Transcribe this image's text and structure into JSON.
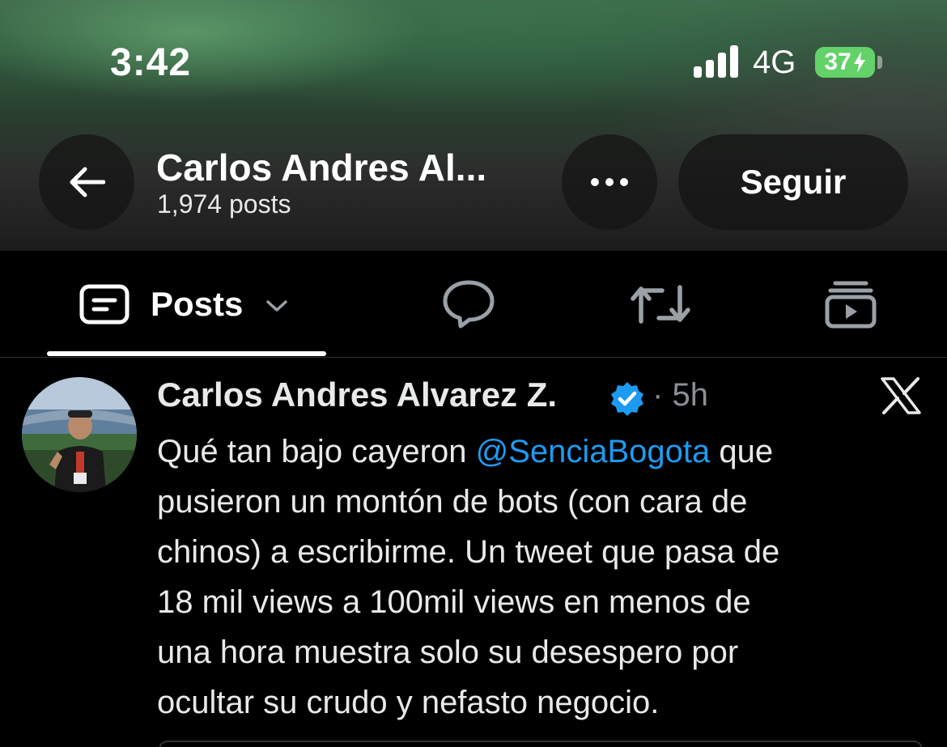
{
  "status_bar": {
    "time": "3:42",
    "network": "4G",
    "battery": "37",
    "battery_color": "#62d269"
  },
  "header": {
    "back_icon": "arrow-left-icon",
    "name": "Carlos Andres Al...",
    "posts_count": "1,974 posts",
    "more_icon": "more-horizontal-icon",
    "follow_label": "Seguir"
  },
  "tabs": [
    {
      "icon": "posts-icon",
      "label": "Posts",
      "active": true,
      "dropdown_icon": "chevron-down-icon"
    },
    {
      "icon": "reply-bubble-icon",
      "label": ""
    },
    {
      "icon": "repost-icon",
      "label": ""
    },
    {
      "icon": "media-video-icon",
      "label": ""
    }
  ],
  "tweet": {
    "author_name": "Carlos Andres Alvarez Z.",
    "verified": true,
    "verified_color": "#1d9bf0",
    "separator": "·",
    "time_ago": "5h",
    "source_icon": "x-logo-icon",
    "text_lines": [
      {
        "before": "Qué tan bajo cayeron ",
        "mention": "@SenciaBogota",
        "after": " que"
      },
      "pusieron un montón de bots (con cara de",
      "chinos) a escribirme. Un tweet que pasa de",
      "18 mil views a 100mil views en menos de",
      "una hora muestra solo su desespero por",
      "ocultar su crudo y nefasto negocio."
    ],
    "mention_color": "#1d9bf0"
  }
}
